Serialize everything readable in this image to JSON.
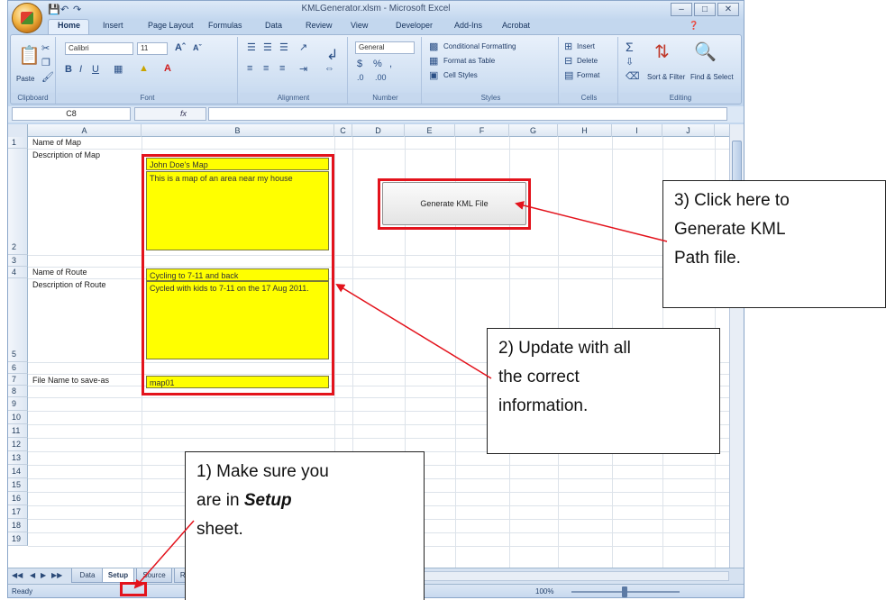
{
  "window": {
    "title": "KMLGenerator.xlsm - Microsoft Excel",
    "tabs": [
      "Home",
      "Insert",
      "Page Layout",
      "Formulas",
      "Data",
      "Review",
      "View",
      "Developer",
      "Add-Ins",
      "Acrobat"
    ]
  },
  "ribbon": {
    "clipboard": {
      "paste": "Paste",
      "label": "Clipboard"
    },
    "font": {
      "name": "Calibri",
      "size": "11",
      "label": "Font"
    },
    "alignment": {
      "label": "Alignment"
    },
    "number": {
      "format": "General",
      "label": "Number"
    },
    "styles": {
      "conditional": "Conditional Formatting",
      "format_table": "Format as Table",
      "cell_styles": "Cell Styles",
      "label": "Styles"
    },
    "cells": {
      "insert": "Insert",
      "delete": "Delete",
      "format": "Format",
      "label": "Cells"
    },
    "editing": {
      "sort": "Sort & Filter",
      "find": "Find & Select",
      "label": "Editing"
    }
  },
  "formula_bar": {
    "name_box": "C8",
    "fx": "fx",
    "value": ""
  },
  "columns": [
    "A",
    "B",
    "C",
    "D",
    "E",
    "F",
    "G",
    "H",
    "I",
    "J"
  ],
  "rows": [
    "1",
    "2",
    "3",
    "4",
    "5",
    "6",
    "7",
    "8",
    "9",
    "10",
    "11",
    "12",
    "13",
    "14",
    "15",
    "16",
    "17",
    "18",
    "19"
  ],
  "cells": {
    "a1": "Name of Map",
    "a2": "Description of Map",
    "a4": "Name of Route",
    "a5": "Description of Route",
    "a7": "File Name to save-as",
    "b1": "John Doe's Map",
    "b2": "This is a map of an area near my house",
    "b4": "Cycling to 7-11 and back",
    "b5": "Cycled with kids to 7-11 on the 17 Aug 2011.",
    "b7": "map01"
  },
  "button": {
    "label": "Generate KML File"
  },
  "sheets": [
    "Data",
    "Setup",
    "Source",
    "Random"
  ],
  "active_sheet": "Setup",
  "status": {
    "mode": "Ready",
    "zoom": "100%"
  },
  "callouts": {
    "c1": {
      "line1": "1) Make sure you",
      "line2a": "are in ",
      "line2b": "Setup",
      "line3": "sheet."
    },
    "c2": {
      "line1": "2) Update with all",
      "line2": "the correct",
      "line3": "information."
    },
    "c3": {
      "line1": "3) Click here to",
      "line2": "Generate KML",
      "line3": "Path file."
    }
  },
  "colors": {
    "highlight": "#e3131c",
    "cell_fill": "#ffff00",
    "ribbon": "#dbe7f6"
  }
}
